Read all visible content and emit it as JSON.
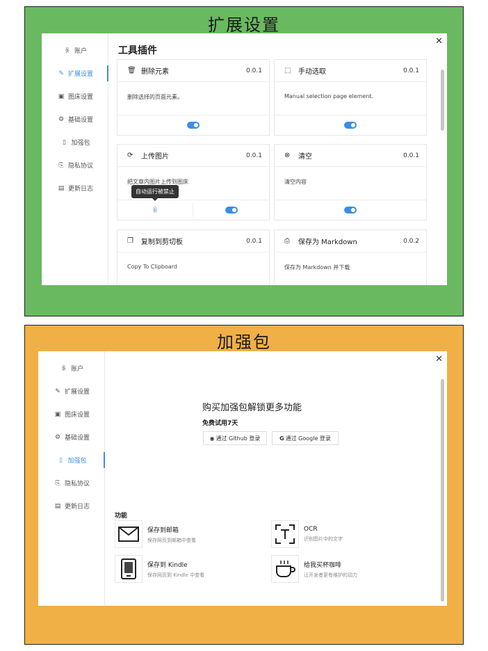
{
  "panel1": {
    "title": "扩展设置",
    "sidebar": {
      "items": [
        {
          "label": "账户"
        },
        {
          "label": "扩展设置"
        },
        {
          "label": "图床设置"
        },
        {
          "label": "基础设置"
        },
        {
          "label": "加强包"
        },
        {
          "label": "隐私协议"
        },
        {
          "label": "更新日志"
        }
      ]
    },
    "section_title": "工具插件",
    "cards": [
      {
        "name": "删除元素",
        "version": "0.0.1",
        "desc": "删除选择的页面元素。",
        "enabled": true
      },
      {
        "name": "手动选取",
        "version": "0.0.1",
        "desc": "Manual selection page element.",
        "enabled": true
      },
      {
        "name": "上传图片",
        "version": "0.0.1",
        "desc": "把文章内图片上传到图床",
        "enabled": true
      },
      {
        "name": "清空",
        "version": "0.0.1",
        "desc": "清空内容",
        "enabled": true
      },
      {
        "name": "复制到剪切板",
        "version": "0.0.1",
        "desc": "Copy To Clipboard"
      },
      {
        "name": "保存为 Markdown",
        "version": "0.0.2",
        "desc": "保存为 Markdown 并下载"
      }
    ],
    "tooltip": "自动运行被禁止"
  },
  "panel2": {
    "title": "加强包",
    "sidebar": {
      "items": [
        {
          "label": "账户"
        },
        {
          "label": "扩展设置"
        },
        {
          "label": "图床设置"
        },
        {
          "label": "基础设置"
        },
        {
          "label": "加强包"
        },
        {
          "label": "隐私协议"
        },
        {
          "label": "更新日志"
        }
      ]
    },
    "promo_title": "购买加强包解锁更多功能",
    "trial_text": "免费试用7天",
    "github_login": "通过 Github 登录",
    "google_login": "通过 Google 登录",
    "features_title": "功能",
    "features": [
      {
        "name": "保存到邮箱",
        "desc": "保存网页到邮箱中查看",
        "icon": "mail-icon"
      },
      {
        "name": "OCR",
        "desc": "识别图片中的文字",
        "icon": "ocr-icon"
      },
      {
        "name": "保存到 Kindle",
        "desc": "保存网页到 Kindle 中查看",
        "icon": "kindle-icon"
      },
      {
        "name": "给我买杯咖啡",
        "desc": "让开发者更有维护的动力",
        "icon": "coffee-icon"
      }
    ]
  },
  "colors": {
    "accent": "#3a8ee6",
    "green_bg": "#69b961",
    "orange_bg": "#f1b045"
  }
}
